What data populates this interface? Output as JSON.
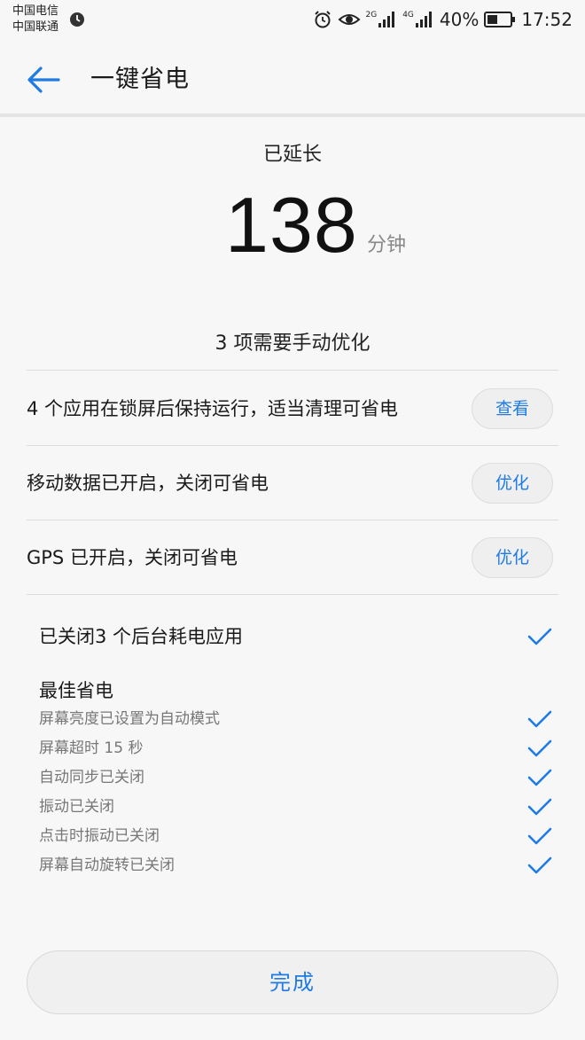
{
  "status_bar": {
    "carrier_1": "中国电信",
    "carrier_2": "中国联通",
    "network_1": "2G",
    "network_2": "4G",
    "battery_percent": "40%",
    "time": "17:52"
  },
  "header": {
    "title": "一键省电",
    "back_icon": "arrow-left-icon"
  },
  "summary": {
    "extended_label": "已延长",
    "extended_minutes": "138",
    "unit": "分钟",
    "manual_count": "3 项需要手动优化"
  },
  "manual_items": [
    {
      "text": "4 个应用在锁屏后保持运行，适当清理可省电",
      "button": "查看"
    },
    {
      "text": "移动数据已开启，关闭可省电",
      "button": "优化"
    },
    {
      "text": "GPS 已开启，关闭可省电",
      "button": "优化"
    }
  ],
  "closed_apps": "已关闭3 个后台耗电应用",
  "best_saving": {
    "title": "最佳省电",
    "items": [
      "屏幕亮度已设置为自动模式",
      "屏幕超时 15 秒",
      "自动同步已关闭",
      "振动已关闭",
      "点击时振动已关闭",
      "屏幕自动旋转已关闭"
    ]
  },
  "done_button": "完成",
  "colors": {
    "accent": "#1f7be3",
    "background": "#f7f7f7"
  }
}
